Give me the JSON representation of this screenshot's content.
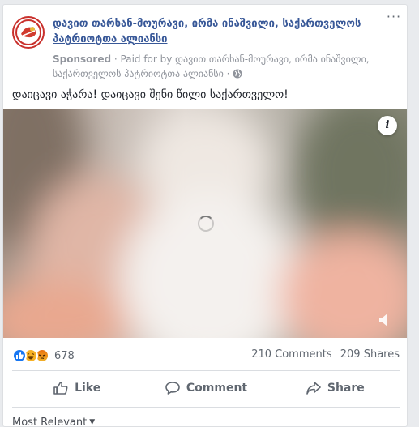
{
  "post": {
    "page_name": "დავით თარხან-მოურავი, ირმა ინაშვილი, საქართველოს პატრიოტთა ალიანსი",
    "sponsored_label": "Sponsored",
    "paid_for": "· Paid for by დავით თარხან-მოურავი, ირმა ინაშვილი, საქართველოს პატრიოტთა ალიანსი ·",
    "text": "დაიცავი აჭარა! დაიცავი შენი წილი საქართველო!",
    "more_icon_glyph": "···",
    "info_icon_glyph": "i"
  },
  "stats": {
    "reaction_count": "678",
    "comments": "210 Comments",
    "shares": "209 Shares",
    "reaction_icons": [
      "like-icon",
      "haha-icon",
      "angry-icon"
    ]
  },
  "actions": {
    "like": "Like",
    "comment": "Comment",
    "share": "Share"
  },
  "comments_sort": {
    "label": "Most Relevant"
  },
  "colors": {
    "link": "#385898",
    "meta": "#90949c",
    "action": "#606770",
    "like_blue": "#1877f2"
  }
}
